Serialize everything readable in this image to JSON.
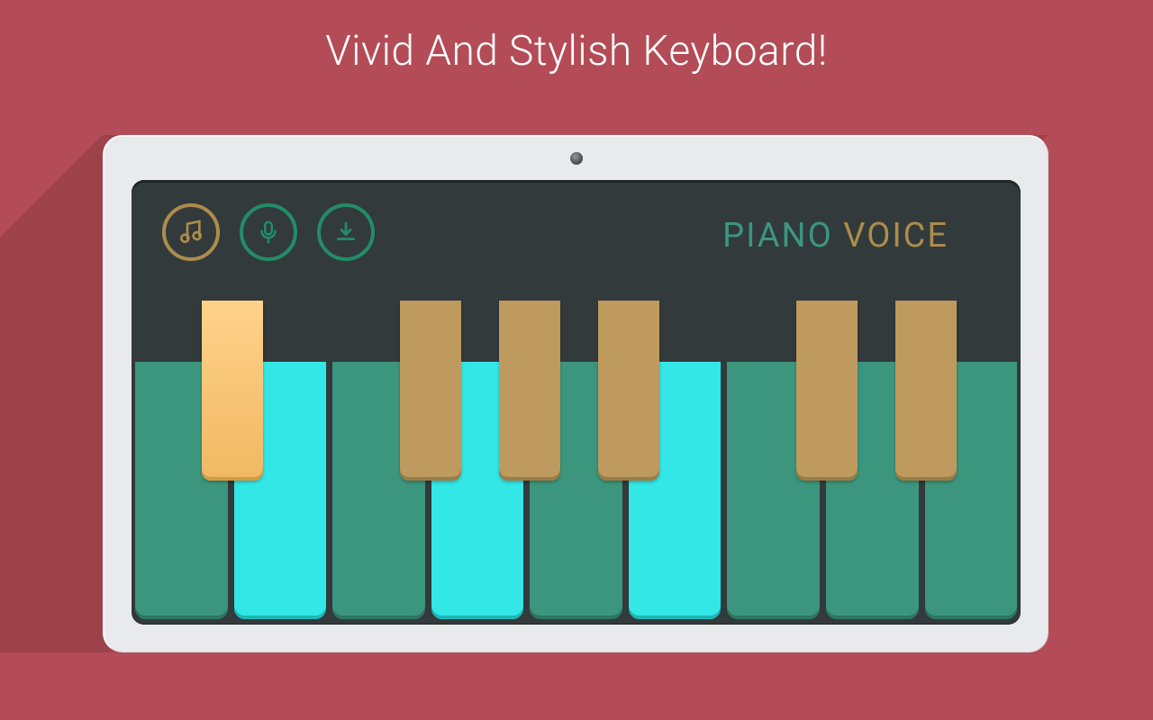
{
  "headline": "Vivid And Stylish Keyboard!",
  "app_title": {
    "word1": "PIANO",
    "word2": "VOICE"
  },
  "icons": {
    "music": "music-note-icon",
    "mic": "microphone-icon",
    "save": "download-icon"
  },
  "colors": {
    "background": "#b34c56",
    "tablet_frame": "#e9eaec",
    "screen": "#323a3c",
    "gold": "#ad8c4b",
    "green_accent": "#238c67",
    "white_key": "#3c967d",
    "white_key_lit": "#33e7e7",
    "black_key": "#be9a5e",
    "black_key_lit": "#f3bf74"
  },
  "keyboard": {
    "white_keys": [
      {
        "n": 1,
        "lit": false
      },
      {
        "n": 2,
        "lit": true
      },
      {
        "n": 3,
        "lit": false
      },
      {
        "n": 4,
        "lit": true
      },
      {
        "n": 5,
        "lit": false
      },
      {
        "n": 6,
        "lit": true
      },
      {
        "n": 7,
        "lit": false
      },
      {
        "n": 8,
        "lit": false
      },
      {
        "n": 9,
        "lit": false
      }
    ],
    "black_keys": [
      {
        "pos": "1-2",
        "lit": true
      },
      {
        "pos": "3-4",
        "lit": false
      },
      {
        "pos": "4-5",
        "lit": false
      },
      {
        "pos": "5-6",
        "lit": false
      },
      {
        "pos": "7-8",
        "lit": false
      },
      {
        "pos": "8-9",
        "lit": false
      }
    ]
  }
}
